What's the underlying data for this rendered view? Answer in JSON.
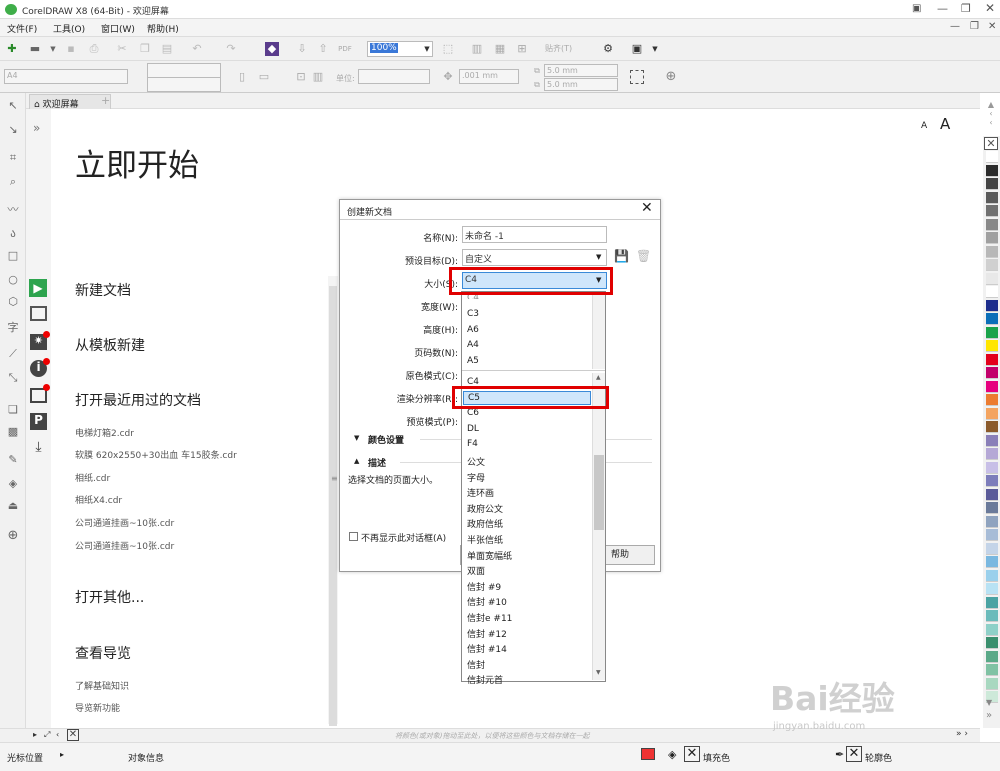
{
  "window": {
    "title": "CorelDRAW X8 (64-Bit) - 欢迎屏幕"
  },
  "menu": [
    "文件(F)",
    "工具(O)",
    "窗口(W)",
    "帮助(H)"
  ],
  "toolbar": {
    "zoom": "100%",
    "snap_label": "贴齐(T)"
  },
  "propbar": {
    "page_size": "A4",
    "units_label": "单位:",
    "nudge": ".001 mm",
    "dup_x": "5.0 mm",
    "dup_y": "5.0 mm"
  },
  "doc_tab": {
    "label": "欢迎屏幕"
  },
  "welcome": {
    "heading": "立即开始",
    "new_doc": "新建文档",
    "from_template": "从模板新建",
    "open_recent": "打开最近用过的文档",
    "recent_files": [
      "电梯灯箱2.cdr",
      "软膜 620x2550+30出血 车15胶条.cdr",
      "相纸.cdr",
      "相纸X4.cdr",
      "公司通道挂画~10张.cdr",
      "公司通道挂画~10张.cdr"
    ],
    "open_other": "打开其他...",
    "tour": "查看导览",
    "tour_links": [
      "了解基础知识",
      "导览新功能"
    ],
    "font_a_small": "A",
    "font_a_large": "A"
  },
  "dialog": {
    "title": "创建新文档",
    "name_label": "名称(N):",
    "name_value": "未命名 -1",
    "preset_label": "预设目标(D):",
    "preset_value": "自定义",
    "size_label": "大小(S):",
    "size_value": "C4",
    "width_label": "宽度(W):",
    "height_label": "高度(H):",
    "pages_label": "页码数(N):",
    "color_mode_label": "原色模式(C):",
    "render_res_label": "渲染分辨率(R):",
    "preview_mode_label": "预览模式(P):",
    "color_settings": "颜色设置",
    "description_head": "描述",
    "description_text": "选择文档的页面大小。",
    "dont_show": "不再显示此对话框(A)",
    "help_button": "帮助"
  },
  "dropdown": {
    "items_top": [
      "C4",
      "C3",
      "A6",
      "A4",
      "A5"
    ],
    "items_list": [
      "C4",
      "C5",
      "C6",
      "DL",
      "F4",
      "公文",
      "字母",
      "连环画",
      "政府公文",
      "政府信纸",
      "半张信纸",
      "单面宽幅纸",
      "双面",
      "信封 #9",
      "信封 #10",
      "信封e #11",
      "信封 #12",
      "信封 #14",
      "信封",
      "信封元首"
    ],
    "selected": "C5"
  },
  "statusbar": {
    "hint": "将颜色(或对象)拖动至此处，以便将这些颜色与文档存储在一起",
    "cursor_pos": "光标位置",
    "object_info": "对象信息",
    "fill": "填充色",
    "outline": "轮廓色"
  },
  "watermark": {
    "brand": "Bai经验",
    "url": "jingyan.baidu.com"
  },
  "palette_colors": [
    "#ffffff",
    "#2b2b2b",
    "#444444",
    "#5a5a5a",
    "#707070",
    "#888888",
    "#a0a0a0",
    "#b8b8b8",
    "#d0d0d0",
    "#e8e8e8",
    "#ffffff",
    "#1c2d8c",
    "#0b6fb8",
    "#1aa34a",
    "#ffe600",
    "#e3001b",
    "#c2006b",
    "#e6007e",
    "#ec7c30",
    "#f4a460",
    "#8b5a2b",
    "#8a7fb8",
    "#b5a8d6",
    "#c8bfe7",
    "#7d7dbb",
    "#5b5b99",
    "#6a7a9a",
    "#8fa3bf",
    "#a7bcd7",
    "#c4d4e8",
    "#7ab8e0",
    "#9ad0ec",
    "#b8e2f4",
    "#4aa3a3",
    "#6bbbbb",
    "#8fd0c8",
    "#3a8f6e",
    "#5aa988",
    "#80c2a4",
    "#a8d8c0",
    "#cde9d9"
  ]
}
